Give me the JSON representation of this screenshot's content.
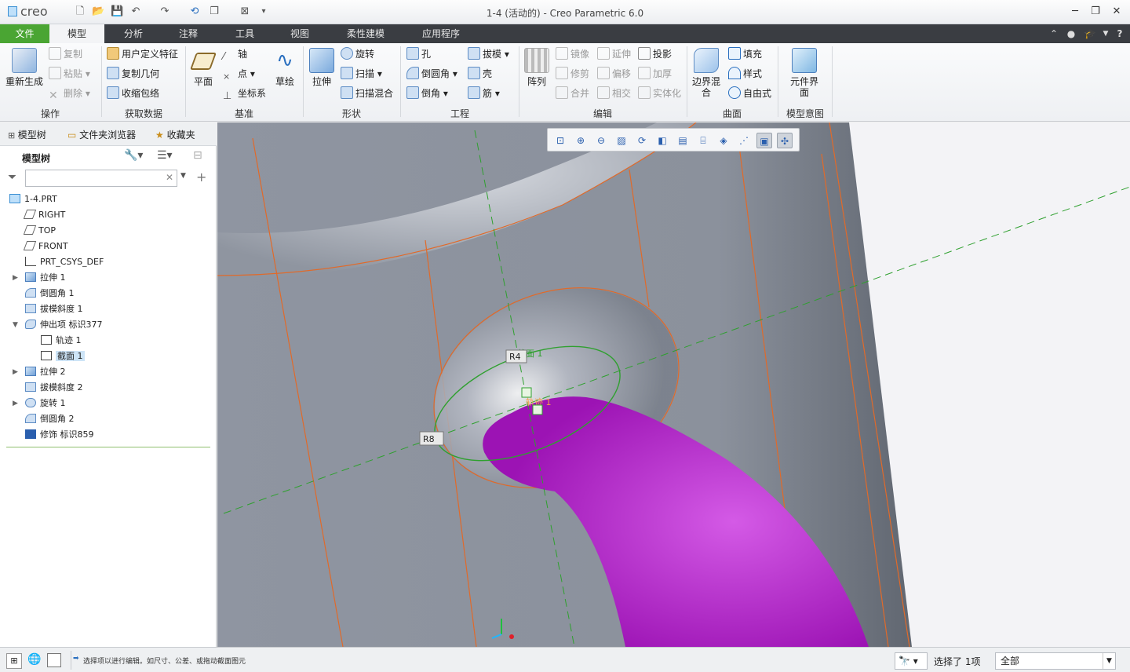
{
  "window": {
    "title": "1-4 (活动的) - Creo Parametric 6.0",
    "logo": "creo"
  },
  "quick_access": [
    "new-icon",
    "open-icon",
    "save-icon",
    "undo-icon",
    "redo-icon",
    "regenerate-icon",
    "windows-icon",
    "close-window-icon",
    "customize-icon"
  ],
  "tabs": [
    "文件",
    "模型",
    "分析",
    "注释",
    "工具",
    "视图",
    "柔性建模",
    "应用程序"
  ],
  "ribbon": {
    "ops": {
      "regen": "重新生成",
      "copy": "复制",
      "paste": "粘贴",
      "delete": "删除",
      "label": "操作"
    },
    "getdata": {
      "udf": "用户定义特征",
      "copygeom": "复制几何",
      "shrink": "收缩包络",
      "label": "获取数据"
    },
    "datum": {
      "plane": "平面",
      "axis": "轴",
      "point": "点",
      "csys": "坐标系",
      "sketch": "草绘",
      "label": "基准"
    },
    "shape": {
      "extrude": "拉伸",
      "revolve": "旋转",
      "sweep": "扫描",
      "swept_blend": "扫描混合",
      "label": "形状"
    },
    "eng": {
      "hole": "孔",
      "round": "倒圆角",
      "chamfer": "倒角",
      "draft": "拔模",
      "shell": "壳",
      "rib": "筋",
      "label": "工程"
    },
    "edit": {
      "pattern": "阵列",
      "mirror": "镜像",
      "extend": "延伸",
      "project": "投影",
      "trim": "修剪",
      "offset": "偏移",
      "thicken": "加厚",
      "merge": "合并",
      "intersect": "相交",
      "solidify": "实体化",
      "label": "编辑"
    },
    "surface": {
      "boundary": "边界混合",
      "fill": "填充",
      "style": "样式",
      "freestyle": "自由式",
      "label": "曲面"
    },
    "intent": {
      "component": "元件界面",
      "label": "模型意图"
    }
  },
  "navigator": {
    "tabs": [
      "模型树",
      "文件夹浏览器",
      "收藏夹"
    ],
    "title": "模型树",
    "search_value": ""
  },
  "tree": [
    {
      "label": "1-4.PRT",
      "icon": "part-icon",
      "indent": 0,
      "exp": ""
    },
    {
      "label": "RIGHT",
      "icon": "plane-icon",
      "indent": 1,
      "exp": ""
    },
    {
      "label": "TOP",
      "icon": "plane-icon",
      "indent": 1,
      "exp": ""
    },
    {
      "label": "FRONT",
      "icon": "plane-icon",
      "indent": 1,
      "exp": ""
    },
    {
      "label": "PRT_CSYS_DEF",
      "icon": "csys-icon",
      "indent": 1,
      "exp": ""
    },
    {
      "label": "拉伸 1",
      "icon": "extrude-icon",
      "indent": 1,
      "exp": "▶"
    },
    {
      "label": "倒圆角 1",
      "icon": "round-icon",
      "indent": 1,
      "exp": ""
    },
    {
      "label": "拔模斜度 1",
      "icon": "draft-icon",
      "indent": 1,
      "exp": ""
    },
    {
      "label": "伸出项 标识377",
      "icon": "sweep-icon",
      "indent": 1,
      "exp": "▼"
    },
    {
      "label": "轨迹 1",
      "icon": "sketch-icon",
      "indent": 2,
      "exp": ""
    },
    {
      "label": "截面 1",
      "icon": "sketch-icon",
      "indent": 2,
      "exp": "",
      "selected": true
    },
    {
      "label": "拉伸 2",
      "icon": "extrude-icon",
      "indent": 1,
      "exp": "▶"
    },
    {
      "label": "拔模斜度 2",
      "icon": "draft-icon",
      "indent": 1,
      "exp": ""
    },
    {
      "label": "旋转 1",
      "icon": "revolve-icon",
      "indent": 1,
      "exp": "▶"
    },
    {
      "label": "倒圆角 2",
      "icon": "round-icon",
      "indent": 1,
      "exp": ""
    },
    {
      "label": "修饰 标识859",
      "icon": "cosmetic-icon",
      "indent": 1,
      "exp": ""
    }
  ],
  "viewport": {
    "labels": {
      "section": "截面 1",
      "trajectory": "轨迹 1",
      "dim_r4": "R4",
      "dim_r8": "R8"
    },
    "colors": {
      "background": "#8b919c",
      "sweep": "#b020c8",
      "edge": "#e06a2a",
      "datum": "#2fa02f"
    }
  },
  "graphics_toolbar": [
    "refit-icon",
    "zoom-in-icon",
    "zoom-out-icon",
    "repaint-icon",
    "reorient-icon",
    "display-style-icon",
    "saved-views-icon",
    "view-manager-icon",
    "perspective-icon",
    "datum-display-icon",
    "annotation-display-icon",
    "spin-center-icon"
  ],
  "status": {
    "message": "选择项以进行编辑。如尺寸、公差、或拖动截面图元",
    "selection": "选择了 1项",
    "filter": "全部"
  }
}
